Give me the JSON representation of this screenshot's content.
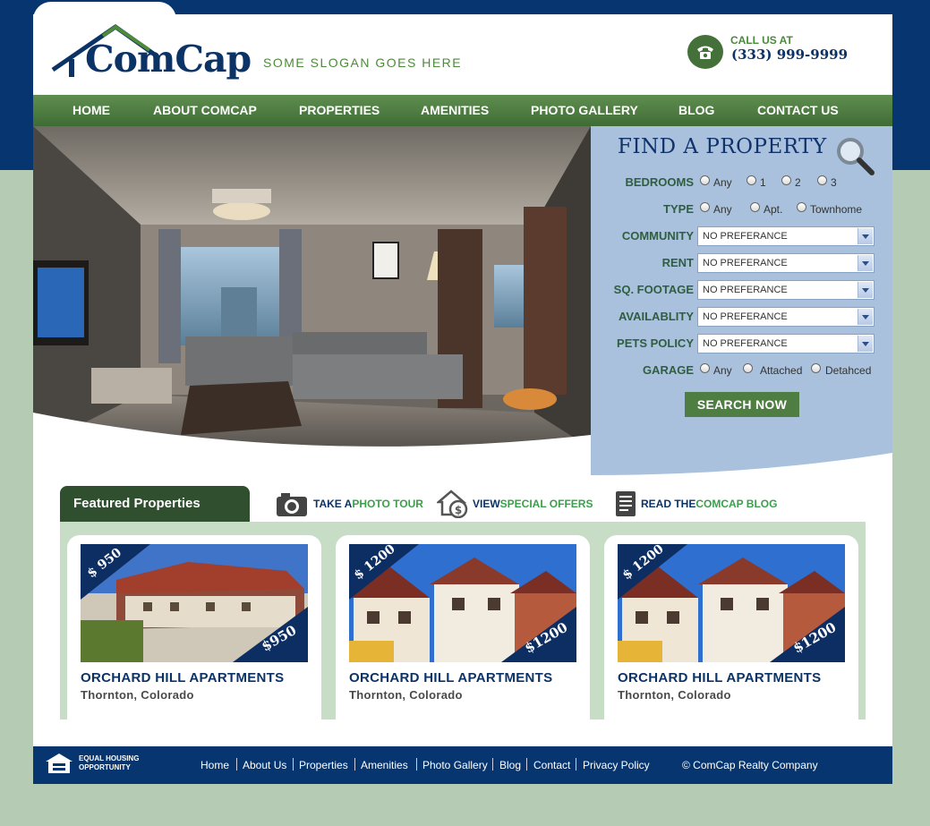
{
  "brand": {
    "name": "ComCap",
    "slogan": "SOME SLOGAN GOES HERE"
  },
  "contact": {
    "label": "CALL US AT",
    "phone": "(333) 999-9999"
  },
  "nav": [
    "HOME",
    "ABOUT COMCAP",
    "PROPERTIES",
    "AMENITIES",
    "PHOTO GALLERY",
    "BLOG",
    "CONTACT US"
  ],
  "finder": {
    "title": "FIND A PROPERTY",
    "bedrooms": {
      "label": "BEDROOMS",
      "options": [
        "Any",
        "1",
        "2",
        "3"
      ]
    },
    "type": {
      "label": "TYPE",
      "options": [
        "Any",
        "Apt.",
        "Townhome"
      ]
    },
    "selects": [
      {
        "label": "COMMUNITY",
        "value": "NO PREFERANCE"
      },
      {
        "label": "RENT",
        "value": "NO PREFERANCE"
      },
      {
        "label": "SQ. FOOTAGE",
        "value": "NO PREFERANCE"
      },
      {
        "label": "AVAILABLITY",
        "value": "NO PREFERANCE"
      },
      {
        "label": "PETS POLICY",
        "value": "NO PREFERANCE"
      }
    ],
    "garage": {
      "label": "GARAGE",
      "options": [
        "Any",
        "Attached",
        "Detahced"
      ]
    },
    "button": "SEARCH NOW"
  },
  "featured": {
    "tab": "Featured Properties",
    "links": [
      {
        "pre": "TAKE A ",
        "accent": "PHOTO TOUR"
      },
      {
        "pre": "VIEW ",
        "accent": "SPECIAL OFFERS"
      },
      {
        "pre": "READ THE ",
        "accent": "COMCAP BLOG"
      }
    ],
    "properties": [
      {
        "title": "ORCHARD HILL APARTMENTS",
        "location": "Thornton, Colorado",
        "price": "$ 950",
        "price2": "$950"
      },
      {
        "title": "ORCHARD HILL APARTMENTS",
        "location": "Thornton, Colorado",
        "price": "$ 1200",
        "price2": "$1200"
      },
      {
        "title": "ORCHARD HILL APARTMENTS",
        "location": "Thornton, Colorado",
        "price": "$ 1200",
        "price2": "$1200"
      }
    ]
  },
  "footer": {
    "eho": [
      "EQUAL HOUSING",
      "OPPORTUNITY"
    ],
    "links": [
      "Home",
      "About Us",
      "Properties",
      "Amenities",
      "Photo Gallery",
      "Blog",
      "Contact",
      "Privacy Policy"
    ],
    "copyright": "© ComCap Realty Company"
  },
  "colors": {
    "navy": "#063570",
    "green": "#4f7e43",
    "finder_bg": "#a9c1dc",
    "page_bg": "#b5cbb3"
  }
}
